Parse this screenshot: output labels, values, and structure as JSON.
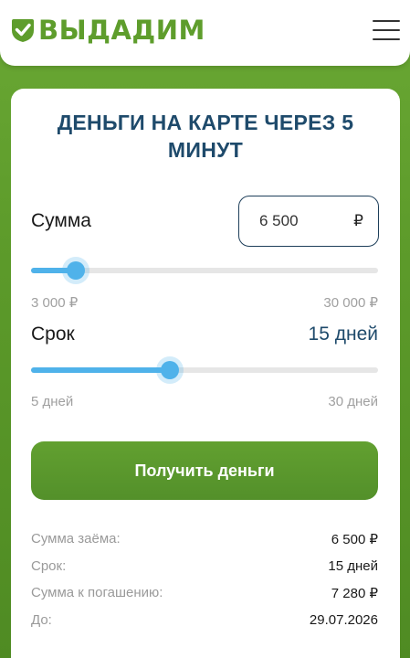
{
  "header": {
    "logo_text": "ВЫДАДИМ",
    "brand_color": "#5e9d2c",
    "menu_icon": "hamburger-menu-icon"
  },
  "calculator": {
    "title": "ДЕНЬГИ НА КАРТЕ ЧЕРЕЗ 5 МИНУТ",
    "amount": {
      "label": "Сумма",
      "value": "6 500",
      "currency": "₽",
      "min_label": "3 000 ₽",
      "max_label": "30 000 ₽",
      "min": 3000,
      "max": 30000,
      "current": 6500
    },
    "term": {
      "label": "Срок",
      "value": "15 дней",
      "min_label": "5 дней",
      "max_label": "30 дней",
      "min": 5,
      "max": 30,
      "current": 15
    },
    "submit_label": "Получить деньги",
    "accent_color": "#4fb2ea"
  },
  "summary": {
    "rows": [
      {
        "label": "Сумма заёма:",
        "value": "6 500 ₽"
      },
      {
        "label": "Срок:",
        "value": "15 дней"
      },
      {
        "label": "Сумма к погашению:",
        "value": "7 280 ₽"
      },
      {
        "label": "До:",
        "value": "29.07.2026"
      }
    ]
  }
}
